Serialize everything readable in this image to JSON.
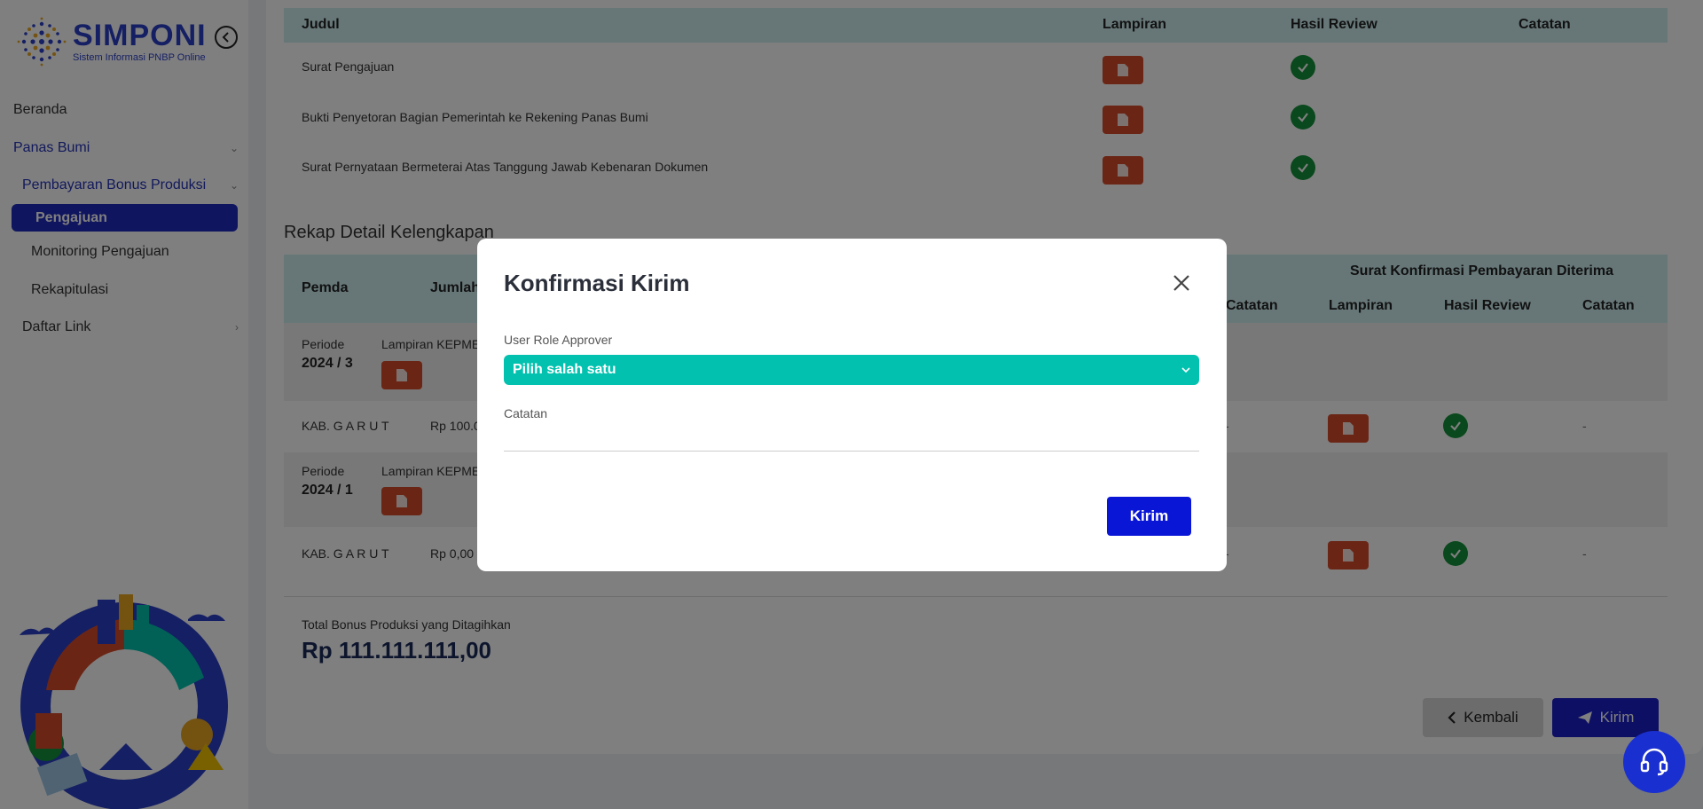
{
  "app": {
    "title": "SIMPONI",
    "subtitle": "Sistem Informasi PNBP Online"
  },
  "sidebar": {
    "items": [
      {
        "label": "Beranda"
      },
      {
        "label": "Panas Bumi"
      },
      {
        "label": "Pembayaran Bonus Produksi"
      },
      {
        "label": "Pengajuan"
      },
      {
        "label": "Monitoring Pengajuan"
      },
      {
        "label": "Rekapitulasi"
      },
      {
        "label": "Daftar Link"
      }
    ]
  },
  "documents_table": {
    "headers": {
      "judul": "Judul",
      "lampiran": "Lampiran",
      "hasil_review": "Hasil Review",
      "catatan": "Catatan"
    },
    "rows": [
      {
        "judul": "Surat Pengajuan"
      },
      {
        "judul": "Bukti Penyetoran Bagian Pemerintah ke Rekening Panas Bumi"
      },
      {
        "judul": "Surat Pernyataan Bermeterai Atas Tanggung Jawab Kebenaran Dokumen"
      }
    ]
  },
  "rekap": {
    "title": "Rekap Detail Kelengkapan",
    "headers": {
      "pemda": "Pemda",
      "jumlah": "Jumlah",
      "group": "Surat Konfirmasi Pembayaran Diterima",
      "catatan_left": "Catatan",
      "lampiran": "Lampiran",
      "hasil_review": "Hasil Review",
      "catatan": "Catatan"
    },
    "periods": [
      {
        "label": "Periode",
        "value": "2024 / 3",
        "lampiran_label": "Lampiran KEPME",
        "row": {
          "pemda": "KAB. G A R U T",
          "jumlah": "Rp 100.0",
          "dash_left": "-",
          "dash_right": "-"
        }
      },
      {
        "label": "Periode",
        "value": "2024 / 1",
        "lampiran_label": "Lampiran KEPME",
        "row": {
          "pemda": "KAB. G A R U T",
          "jumlah": "Rp 0,00",
          "dash_left": "-",
          "dash_right": "-"
        }
      }
    ]
  },
  "total": {
    "label": "Total Bonus Produksi yang Ditagihkan",
    "value": "Rp 111.111.111,00"
  },
  "actions": {
    "back_label": "Kembali",
    "send_label": "Kirim"
  },
  "modal": {
    "title": "Konfirmasi Kirim",
    "role_label": "User Role Approver",
    "role_selected": "Pilih salah satu",
    "note_label": "Catatan",
    "note_value": "",
    "submit_label": "Kirim"
  },
  "colors": {
    "brand": "#2b3fc7",
    "active_nav": "#1f2bbd",
    "table_header": "#cfeff0",
    "pdf": "#d64a2a",
    "success": "#15913a",
    "select": "#02c2af",
    "primary_button": "#0a16d6"
  },
  "icons": {
    "collapse": "chevron-left-circle-icon",
    "pdf": "pdf-file-icon",
    "review": "check-circle-icon",
    "close": "close-icon",
    "send": "paper-plane-icon",
    "help": "headset-icon"
  }
}
